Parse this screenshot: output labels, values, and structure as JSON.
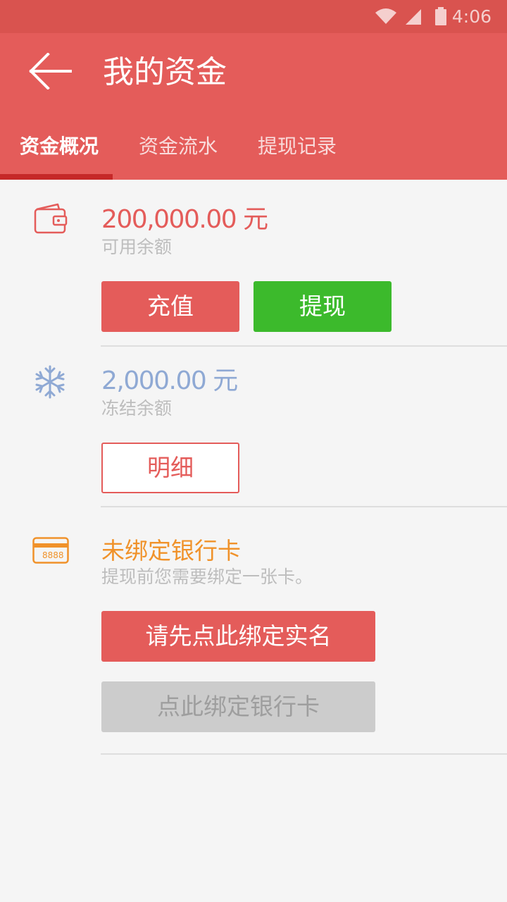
{
  "status_bar": {
    "time": "4:06",
    "wifi_icon": "wifi-icon",
    "signal_icon": "cellular-signal-icon",
    "battery_icon": "battery-icon"
  },
  "app_bar": {
    "title": "我的资金",
    "back_icon": "arrow-left-icon",
    "background_color": "#e45c5a"
  },
  "tabs": [
    {
      "label": "资金概况",
      "active": true
    },
    {
      "label": "资金流水",
      "active": false
    },
    {
      "label": "提现记录",
      "active": false
    }
  ],
  "available": {
    "icon": "wallet-icon",
    "amount": "200,000.00 元",
    "label": "可用余额",
    "recharge_label": "充值",
    "withdraw_label": "提现"
  },
  "frozen": {
    "icon": "snowflake-icon",
    "amount": "2,000.00 元",
    "label": "冻结余额",
    "detail_label": "明细"
  },
  "bank": {
    "icon": "bank-card-icon",
    "card_text": "8888",
    "title": "未绑定银行卡",
    "note": "提现前您需要绑定一张卡。",
    "verify_label": "请先点此绑定实名",
    "bind_card_label": "点此绑定银行卡"
  },
  "colors": {
    "accent": "#e45c5a",
    "withdraw_green": "#3cba2c",
    "frozen_blue": "#8fa9d4",
    "bank_orange": "#f0922a",
    "disabled_gray": "#cccccc"
  }
}
